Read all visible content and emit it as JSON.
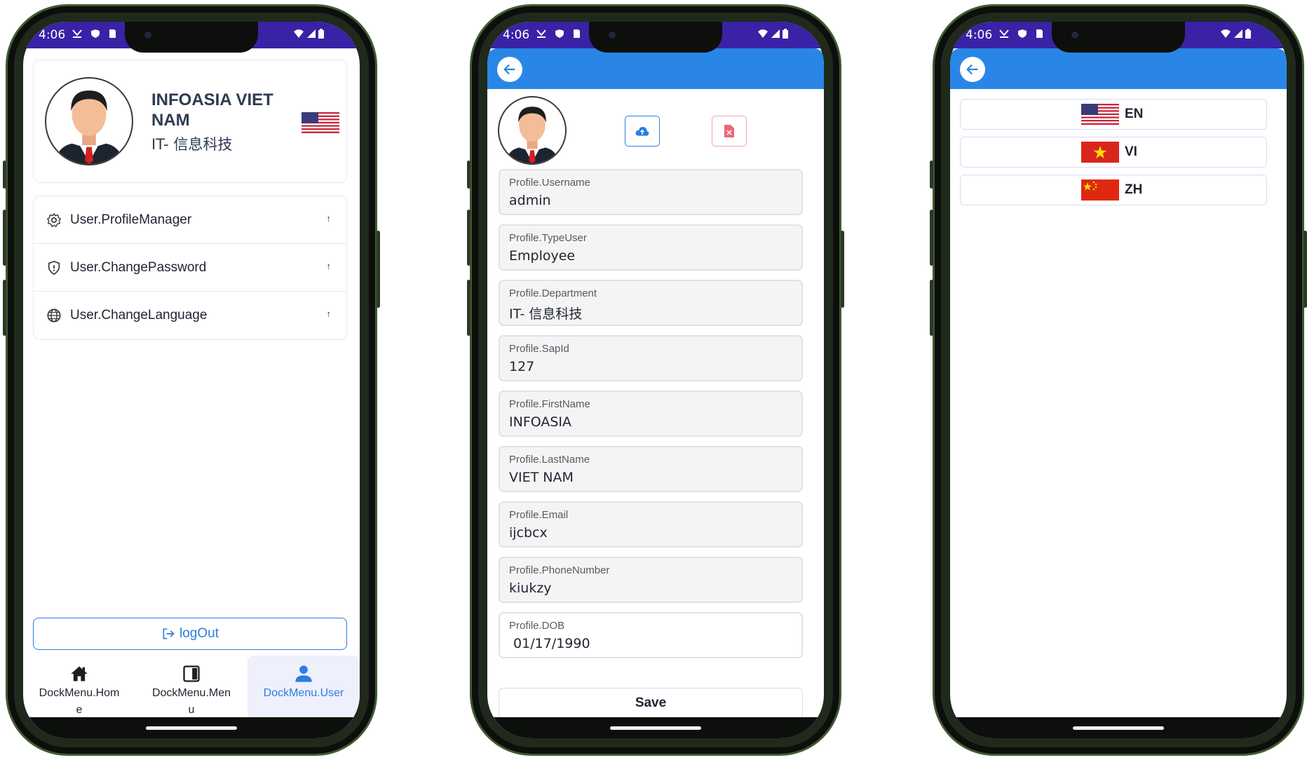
{
  "status_bar": {
    "time": "4:06"
  },
  "phone1": {
    "profile": {
      "name": "INFOASIA VIET NAM",
      "department": "IT- 信息科技"
    },
    "menu": [
      {
        "label": "User.ProfileManager",
        "icon": "gear-icon",
        "arrow": "↑"
      },
      {
        "label": "User.ChangePassword",
        "icon": "shield-icon",
        "arrow": "↑"
      },
      {
        "label": "User.ChangeLanguage",
        "icon": "globe-icon",
        "arrow": "↑"
      }
    ],
    "logout_label": "logOut",
    "dock": [
      {
        "label": "DockMenu.Home",
        "icon": "home-icon",
        "active": false
      },
      {
        "label": "DockMenu.Menu",
        "icon": "menu-panel-icon",
        "active": false
      },
      {
        "label": "DockMenu.User",
        "icon": "user-icon",
        "active": true
      }
    ],
    "accent_color": "#2a7de1"
  },
  "phone2": {
    "fields": [
      {
        "label": "Profile.Username",
        "value": "admin"
      },
      {
        "label": "Profile.TypeUser",
        "value": "Employee"
      },
      {
        "label": "Profile.Department",
        "value": "IT- 信息科技"
      },
      {
        "label": "Profile.SapId",
        "value": "127"
      },
      {
        "label": "Profile.FirstName",
        "value": "INFOASIA"
      },
      {
        "label": "Profile.LastName",
        "value": "VIET NAM"
      },
      {
        "label": "Profile.Email",
        "value": "ijcbcx"
      },
      {
        "label": "Profile.PhoneNumber",
        "value": "kiukzy"
      },
      {
        "label": "Profile.DOB",
        "value": " 01/17/1990"
      }
    ],
    "save_label": "Save",
    "header_color": "#2a86e6"
  },
  "phone3": {
    "languages": [
      {
        "code": "EN",
        "flag": "us-flag-icon"
      },
      {
        "code": "VI",
        "flag": "vn-flag-icon"
      },
      {
        "code": "ZH",
        "flag": "cn-flag-icon"
      }
    ]
  }
}
